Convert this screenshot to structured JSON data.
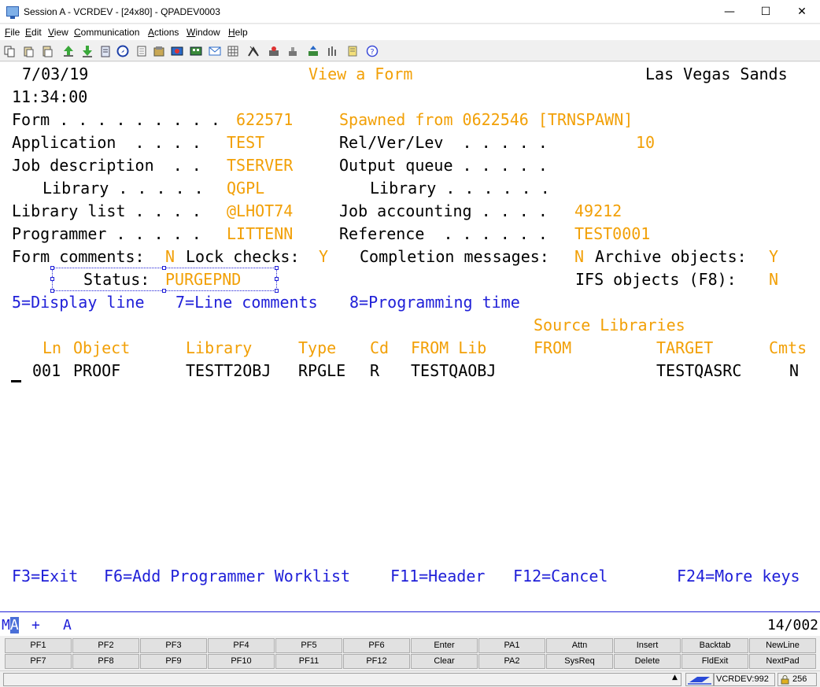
{
  "window": {
    "title": "Session A - VCRDEV - [24x80] - QPADEV0003",
    "minimize": "—",
    "maximize": "☐",
    "close": "✕"
  },
  "menu": [
    "File",
    "Edit",
    "View",
    "Communication",
    "Actions",
    "Window",
    "Help"
  ],
  "toolbar": {
    "icons": [
      "copy-icon",
      "paste-icon",
      "paste-special-icon",
      "send-file-icon",
      "receive-file-icon",
      "print-screen-icon",
      "navigate-icon",
      "notes-icon",
      "macro-icon",
      "record-macro-icon",
      "keypad-icon",
      "mail-icon",
      "grid-icon",
      "settings-icon",
      "play-macro-icon",
      "stop-macro-icon",
      "transfer-icon",
      "bars-icon",
      "notebook-icon",
      "help-icon"
    ]
  },
  "screen": {
    "date": "7/03/19",
    "time": "11:34:00",
    "heading": "View a Form",
    "company": "Las Vegas Sands",
    "form_label": "Form . . . . . . . . .",
    "form_value": "622571",
    "spawned": "Spawned from 0622546 [TRNSPAWN]",
    "application_label": "Application  . . . .",
    "application_value": "TEST",
    "relverlev_label": "Rel/Ver/Lev  . . . . .",
    "relverlev_value": "10",
    "jobdesc_label": "Job description  . .",
    "jobdesc_value": "TSERVER",
    "outq_label": "Output queue . . . . .",
    "library1_label": "Library . . . . .",
    "library1_value": "QGPL",
    "library2_label": "Library . . . . . .",
    "liblist_label": "Library list . . . .",
    "liblist_value": "@LHOT74",
    "jobacct_label": "Job accounting . . . .",
    "jobacct_value": "49212",
    "programmer_label": "Programmer . . . . .",
    "programmer_value": "LITTENN",
    "reference_label": "Reference  . . . . . .",
    "reference_value": "TEST0001",
    "formcomments_label": "Form comments:",
    "formcomments_value": "N",
    "lockchecks_label": "Lock checks:",
    "lockchecks_value": "Y",
    "completion_label": "Completion messages:",
    "completion_value": "N",
    "archive_label": "Archive objects:",
    "archive_value": "Y",
    "status_label": "Status:",
    "status_value": "PURGEPND",
    "ifs_label": "IFS objects (F8):",
    "ifs_value": "N",
    "opt5": "5=Display line",
    "opt7": "7=Line comments",
    "opt8": "8=Programming time",
    "source_libraries": "Source Libraries",
    "columns": {
      "ln": "Ln",
      "object": "Object",
      "library": "Library",
      "type": "Type",
      "cd": "Cd",
      "from_lib": "FROM Lib",
      "from": "FROM",
      "target": "TARGET",
      "cmts": "Cmts"
    },
    "rows": [
      {
        "ln": "001",
        "object": "PROOF",
        "library": "TESTT2OBJ",
        "type": "RPGLE",
        "cd": "R",
        "from_lib": "TESTQAOBJ",
        "from": "",
        "target": "TESTQASRC",
        "cmts": "N"
      }
    ],
    "fkeys": {
      "f3": "F3=Exit",
      "f6": "F6=Add Programmer Worklist",
      "f11": "F11=Header",
      "f12": "F12=Cancel",
      "f24": "F24=More keys"
    }
  },
  "oia": {
    "ma_m": "M",
    "ma_a": "A",
    "plus": "+",
    "a": "A",
    "cursor_pos": "14/002"
  },
  "keypad": {
    "row1": [
      "PF1",
      "PF2",
      "PF3",
      "PF4",
      "PF5",
      "PF6",
      "Enter",
      "PA1",
      "Attn",
      "Insert",
      "Backtab",
      "NewLine"
    ],
    "row2": [
      "PF7",
      "PF8",
      "PF9",
      "PF10",
      "PF11",
      "PF12",
      "Clear",
      "PA2",
      "SysReq",
      "Delete",
      "FldExit",
      "NextPad"
    ]
  },
  "statusbar": {
    "host": "VCRDEV:992",
    "port": "256"
  }
}
